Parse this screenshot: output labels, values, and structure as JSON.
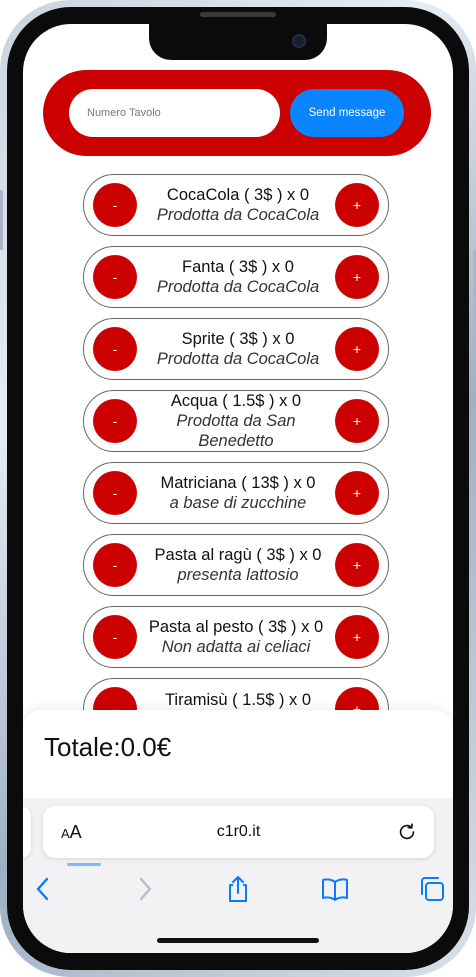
{
  "header": {
    "table_placeholder": "Numero Tavolo",
    "send_label": "Send message"
  },
  "products": [
    {
      "title": "CocaCola ( 3$ ) x 0",
      "desc": "Prodotta da CocaCola",
      "minus": "-",
      "plus": "+"
    },
    {
      "title": "Fanta ( 3$ ) x 0",
      "desc": "Prodotta da CocaCola",
      "minus": "-",
      "plus": "+"
    },
    {
      "title": "Sprite ( 3$ ) x 0",
      "desc": "Prodotta da CocaCola",
      "minus": "-",
      "plus": "+"
    },
    {
      "title": "Acqua ( 1.5$ ) x 0",
      "desc": "Prodotta da San Benedetto",
      "minus": "-",
      "plus": "+"
    },
    {
      "title": "Matriciana ( 13$ ) x 0",
      "desc": "a base di zucchine",
      "minus": "-",
      "plus": "+"
    },
    {
      "title": "Pasta al ragù ( 3$ ) x 0",
      "desc": "presenta lattosio",
      "minus": "-",
      "plus": "+"
    },
    {
      "title": "Pasta al pesto ( 3$ ) x 0",
      "desc": "Non adatta ai celiaci",
      "minus": "-",
      "plus": "+"
    },
    {
      "title": "Tiramisù ( 1.5$ ) x 0",
      "desc": "",
      "minus": "-",
      "plus": "+"
    }
  ],
  "total": {
    "label": "Totale:0.0€"
  },
  "browser": {
    "aa_small": "A",
    "aa_large": "A",
    "url": "c1r0.it",
    "icons": [
      "back-icon",
      "forward-icon",
      "share-icon",
      "bookmarks-icon",
      "tabs-icon",
      "reload-icon"
    ]
  },
  "colors": {
    "accent_red": "#cc0000",
    "send_blue": "#0a84ff",
    "ios_blue": "#0a7aff"
  }
}
